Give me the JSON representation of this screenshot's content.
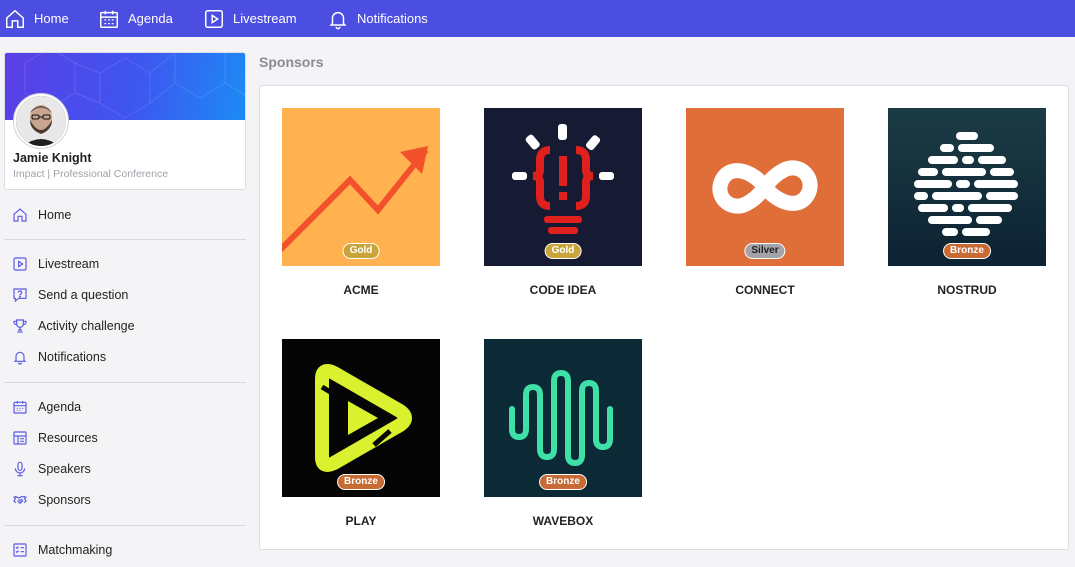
{
  "topnav": {
    "items": [
      {
        "label": "Home",
        "icon": "home-icon"
      },
      {
        "label": "Agenda",
        "icon": "calendar-icon"
      },
      {
        "label": "Livestream",
        "icon": "play-icon"
      },
      {
        "label": "Notifications",
        "icon": "bell-icon"
      }
    ]
  },
  "profile": {
    "name": "Jamie Knight",
    "subtitle": "Impact | Professional Conference"
  },
  "sidebar": {
    "items": [
      {
        "label": "Home",
        "icon": "home-icon"
      },
      {
        "label": "Livestream",
        "icon": "play-icon"
      },
      {
        "label": "Send a question",
        "icon": "question-icon"
      },
      {
        "label": "Activity challenge",
        "icon": "trophy-icon"
      },
      {
        "label": "Notifications",
        "icon": "bell-icon"
      },
      {
        "label": "Agenda",
        "icon": "calendar-icon"
      },
      {
        "label": "Resources",
        "icon": "resources-icon"
      },
      {
        "label": "Speakers",
        "icon": "microphone-icon"
      },
      {
        "label": "Sponsors",
        "icon": "handshake-icon"
      },
      {
        "label": "Matchmaking",
        "icon": "checklist-icon"
      }
    ]
  },
  "main": {
    "title": "Sponsors",
    "sponsors": [
      {
        "name": "ACME",
        "tier": "Gold",
        "bg": "#ffb24f"
      },
      {
        "name": "CODE IDEA",
        "tier": "Gold",
        "bg": "#171a33"
      },
      {
        "name": "CONNECT",
        "tier": "Silver",
        "bg": "#e06e38"
      },
      {
        "name": "NOSTRUD",
        "tier": "Bronze",
        "bg": "#12333f"
      },
      {
        "name": "PLAY",
        "tier": "Bronze",
        "bg": "#050505"
      },
      {
        "name": "WAVEBOX",
        "tier": "Bronze",
        "bg": "#0c2a35"
      }
    ]
  },
  "colors": {
    "nav_bg": "#4b4ee0",
    "accent": "#5b5be6",
    "gold": "#c9a43a",
    "silver": "#a3a3a8",
    "bronze": "#c86a33"
  }
}
